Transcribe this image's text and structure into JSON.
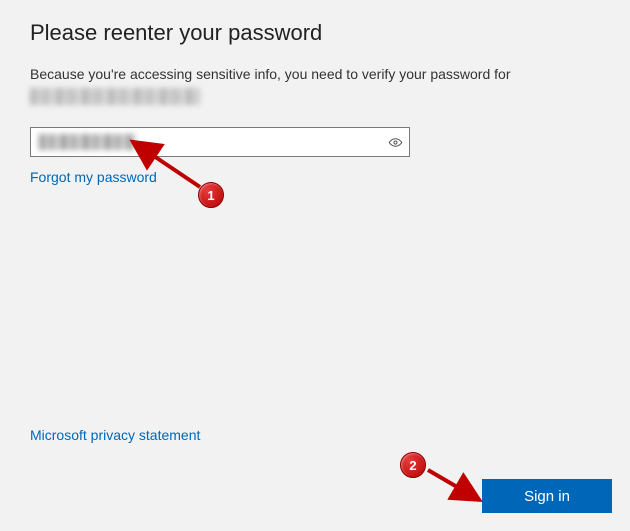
{
  "title": "Please reenter your password",
  "subtitle": "Because you're accessing sensitive info, you need to verify your password for",
  "password": {
    "placeholder": ""
  },
  "links": {
    "forgot": "Forgot my password",
    "privacy": "Microsoft privacy statement"
  },
  "buttons": {
    "signin": "Sign in"
  },
  "annotations": {
    "one": "1",
    "two": "2"
  }
}
